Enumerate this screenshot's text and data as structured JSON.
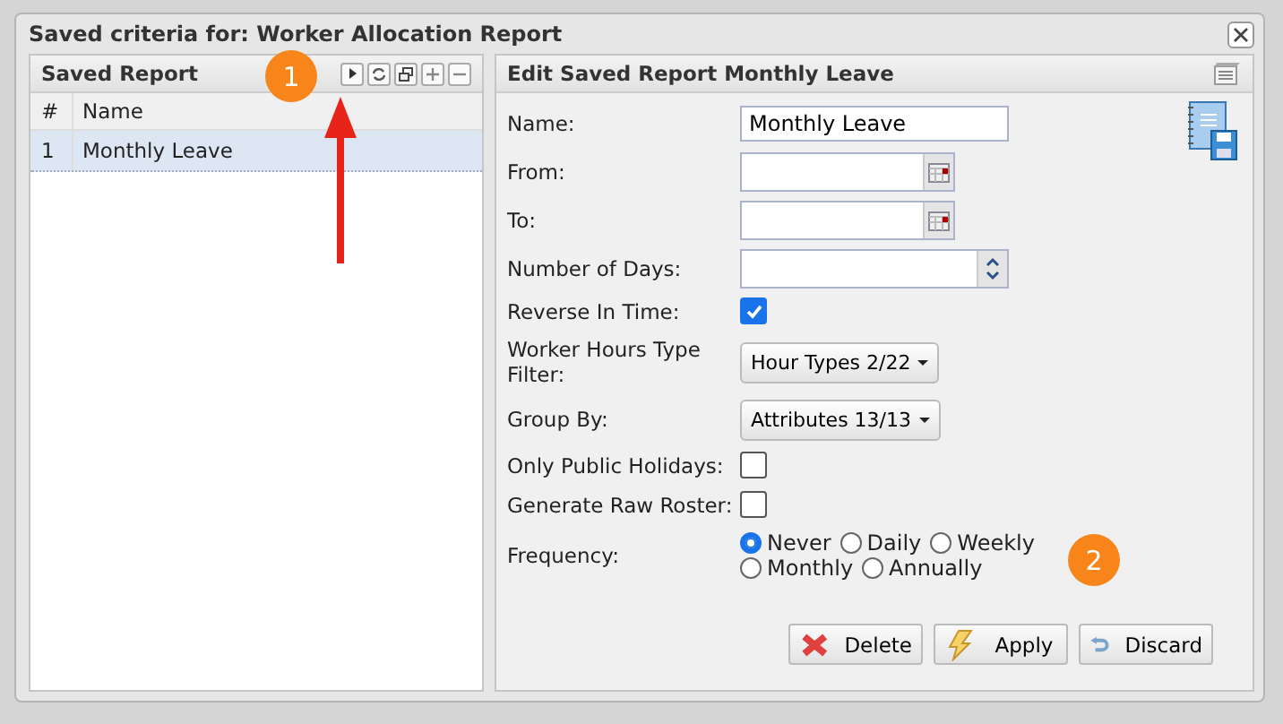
{
  "window": {
    "title": "Saved criteria for: Worker Allocation Report"
  },
  "saved_report": {
    "title": "Saved Report",
    "columns": [
      "#",
      "Name"
    ],
    "rows": [
      {
        "number": "1",
        "name": "Monthly Leave",
        "selected": true
      }
    ]
  },
  "edit_panel": {
    "title": "Edit Saved Report Monthly Leave",
    "fields": [
      {
        "kind": "text",
        "label": "Name:",
        "value": "Monthly Leave"
      },
      {
        "kind": "date",
        "label": "From:"
      },
      {
        "kind": "date",
        "label": "To:"
      },
      {
        "kind": "number",
        "label": "Number of Days:"
      },
      {
        "kind": "checkbox",
        "label": "Reverse In Time:",
        "checked": true
      },
      {
        "kind": "dropdown",
        "label": "Worker Hours Type Filter:",
        "value": "Hour Types 2/22"
      },
      {
        "kind": "dropdown",
        "label": "Group By:",
        "value": "Attributes 13/13"
      },
      {
        "kind": "checkbox",
        "label": "Only Public Holidays:",
        "checked": false
      },
      {
        "kind": "checkbox",
        "label": "Generate Raw Roster:",
        "checked": false
      },
      {
        "kind": "radio",
        "label": "Frequency:",
        "options": [
          {
            "label": "Never",
            "selected": true
          },
          {
            "label": "Daily",
            "selected": false
          },
          {
            "label": "Weekly",
            "selected": false
          },
          {
            "label": "Monthly",
            "selected": false
          },
          {
            "label": "Annually",
            "selected": false
          }
        ]
      }
    ],
    "buttons": [
      {
        "kind": "delete",
        "label": "Delete"
      },
      {
        "kind": "apply",
        "label": "Apply"
      },
      {
        "kind": "discard",
        "label": "Discard"
      }
    ]
  },
  "callouts": [
    "1",
    "2"
  ]
}
